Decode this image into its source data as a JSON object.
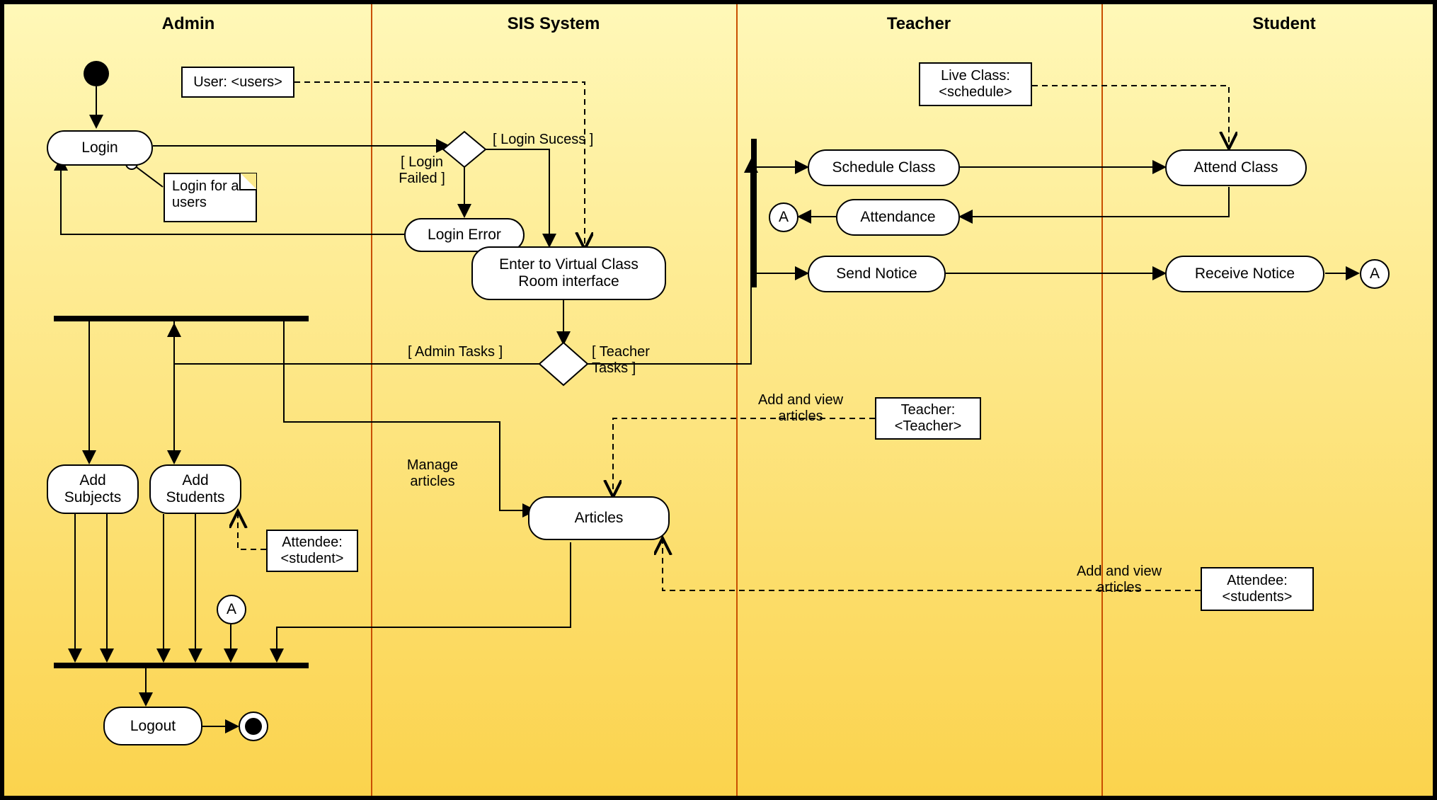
{
  "lanes": {
    "admin": "Admin",
    "sis": "SIS System",
    "teacher": "Teacher",
    "student": "Student"
  },
  "activities": {
    "login": "Login",
    "loginError": "Login Error",
    "enterVCR": "Enter to Virtual Class Room interface",
    "addSubjects": "Add Subjects",
    "addStudents": "Add Students",
    "articles": "Articles",
    "logout": "Logout",
    "scheduleClass": "Schedule Class",
    "attendance": "Attendance",
    "sendNotice": "Send Notice",
    "attendClass": "Attend Class",
    "receiveNotice": "Receive Notice"
  },
  "objects": {
    "user": "User: <users>",
    "attendee": "Attendee: <student>",
    "liveClass": "Live Class: <schedule>",
    "teacher": "Teacher: <Teacher>",
    "attendees": "Attendee: <students>"
  },
  "note": {
    "loginAll": "Login for all users"
  },
  "guards": {
    "loginSuccess": "[ Login Sucess ]",
    "loginFailed": "[ Login Failed ]",
    "adminTasks": "[ Admin Tasks ]",
    "teacherTasks": "[ Teacher Tasks ]",
    "manageArticles": "Manage articles",
    "addViewArticles1": "Add and view articles",
    "addViewArticles2": "Add and view articles"
  },
  "connector": "A"
}
